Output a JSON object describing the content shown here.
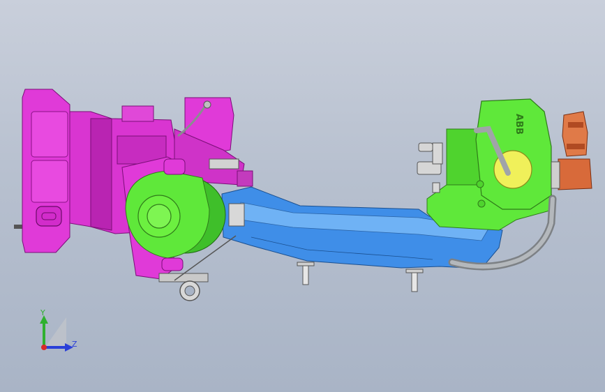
{
  "viewport": {
    "background_top": "#c9cfdb",
    "background_bottom": "#a9b4c6"
  },
  "model": {
    "brand_text": "ABB",
    "colors": {
      "base": "#e03ad8",
      "base_dark": "#a01a9c",
      "upper_arm": "#3f8ee8",
      "upper_arm_light": "#6fb2f5",
      "axis_joint": "#5fe83a",
      "axis_joint_dark": "#2f9a1a",
      "wrist_cap": "#f0f05a",
      "connector": "#d86a3a",
      "cable": "#a0a4a8"
    }
  },
  "triad": {
    "y_label": "Y",
    "z_label": "Z",
    "y_color": "#2fb02f",
    "z_color": "#2a3fd8",
    "origin_color": "#d82a2a"
  }
}
